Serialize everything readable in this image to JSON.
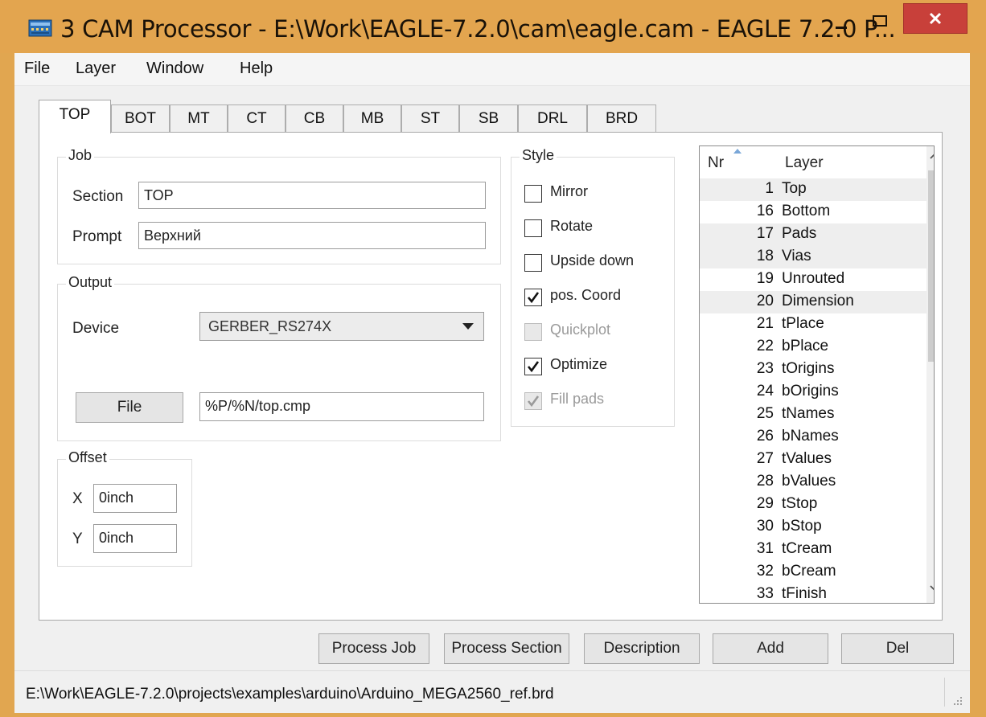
{
  "window": {
    "title": "3 CAM Processor - E:\\Work\\EAGLE-7.2.0\\cam\\eagle.cam - EAGLE 7.2.0 P..."
  },
  "menu": [
    "File",
    "Layer",
    "Window",
    "Help"
  ],
  "tabs": [
    "TOP",
    "BOT",
    "MT",
    "CT",
    "CB",
    "MB",
    "ST",
    "SB",
    "DRL",
    "BRD"
  ],
  "job": {
    "title": "Job",
    "section_label": "Section",
    "section_value": "TOP",
    "prompt_label": "Prompt",
    "prompt_value": "Верхний"
  },
  "output": {
    "title": "Output",
    "device_label": "Device",
    "device_value": "GERBER_RS274X",
    "file_button": "File",
    "file_value": "%P/%N/top.cmp"
  },
  "offset": {
    "title": "Offset",
    "x_label": "X",
    "x_value": "0inch",
    "y_label": "Y",
    "y_value": "0inch"
  },
  "style": {
    "title": "Style",
    "options": [
      {
        "label": "Mirror",
        "checked": false,
        "enabled": true
      },
      {
        "label": "Rotate",
        "checked": false,
        "enabled": true
      },
      {
        "label": "Upside down",
        "checked": false,
        "enabled": true
      },
      {
        "label": "pos. Coord",
        "checked": true,
        "enabled": true
      },
      {
        "label": "Quickplot",
        "checked": false,
        "enabled": false
      },
      {
        "label": "Optimize",
        "checked": true,
        "enabled": true
      },
      {
        "label": "Fill pads",
        "checked": true,
        "enabled": false
      }
    ]
  },
  "layers": {
    "col_nr": "Nr",
    "col_layer": "Layer",
    "rows": [
      {
        "nr": "1",
        "name": "Top",
        "selected": true
      },
      {
        "nr": "16",
        "name": "Bottom",
        "selected": false
      },
      {
        "nr": "17",
        "name": "Pads",
        "selected": true
      },
      {
        "nr": "18",
        "name": "Vias",
        "selected": true
      },
      {
        "nr": "19",
        "name": "Unrouted",
        "selected": false
      },
      {
        "nr": "20",
        "name": "Dimension",
        "selected": true
      },
      {
        "nr": "21",
        "name": "tPlace",
        "selected": false
      },
      {
        "nr": "22",
        "name": "bPlace",
        "selected": false
      },
      {
        "nr": "23",
        "name": "tOrigins",
        "selected": false
      },
      {
        "nr": "24",
        "name": "bOrigins",
        "selected": false
      },
      {
        "nr": "25",
        "name": "tNames",
        "selected": false
      },
      {
        "nr": "26",
        "name": "bNames",
        "selected": false
      },
      {
        "nr": "27",
        "name": "tValues",
        "selected": false
      },
      {
        "nr": "28",
        "name": "bValues",
        "selected": false
      },
      {
        "nr": "29",
        "name": "tStop",
        "selected": false
      },
      {
        "nr": "30",
        "name": "bStop",
        "selected": false
      },
      {
        "nr": "31",
        "name": "tCream",
        "selected": false
      },
      {
        "nr": "32",
        "name": "bCream",
        "selected": false
      },
      {
        "nr": "33",
        "name": "tFinish",
        "selected": false
      }
    ]
  },
  "buttons": {
    "process_job": "Process Job",
    "process_section": "Process Section",
    "description": "Description",
    "add": "Add",
    "del": "Del"
  },
  "status": "E:\\Work\\EAGLE-7.2.0\\projects\\examples\\arduino\\Arduino_MEGA2560_ref.brd",
  "colors": {
    "titlebar": "#e3a54f",
    "close_button": "#c8403a",
    "selected_row": "#eeeeee"
  }
}
